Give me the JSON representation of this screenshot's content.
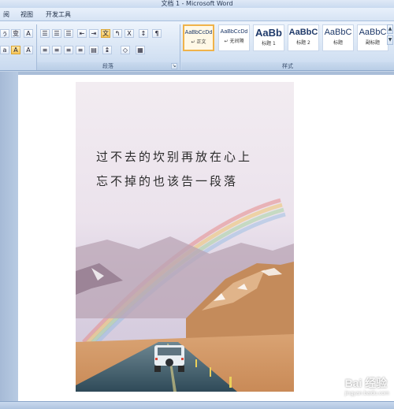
{
  "window": {
    "title": "文档 1 - Microsoft Word"
  },
  "menu": {
    "items": [
      "阅",
      "视图",
      "开发工具"
    ]
  },
  "ribbon": {
    "groups": {
      "paragraph": "段落",
      "styles": "样式"
    },
    "styles": [
      {
        "sample": "AaBbCcDd",
        "name": "↵ 正文",
        "selected": true
      },
      {
        "sample": "AaBbCcDd",
        "name": "↵ 无间隔",
        "selected": false
      },
      {
        "sample": "AaBb",
        "name": "标题 1",
        "selected": false
      },
      {
        "sample": "AaBbC",
        "name": "标题 2",
        "selected": false
      },
      {
        "sample": "AaBbC",
        "name": "标题",
        "selected": false
      },
      {
        "sample": "AaBbC",
        "name": "副标题",
        "selected": false
      }
    ]
  },
  "document": {
    "poem": [
      "过不去的坎别再放在心上",
      "忘不掉的也该告一段落"
    ]
  },
  "watermark": {
    "text": "Bai 经验",
    "sub": "jingyan.baidu.com"
  },
  "colors": {
    "ribbon": "#d4e2f3",
    "selection": "#f0b34a",
    "sky": "#ece2ec",
    "road": "#3c5a6a"
  }
}
